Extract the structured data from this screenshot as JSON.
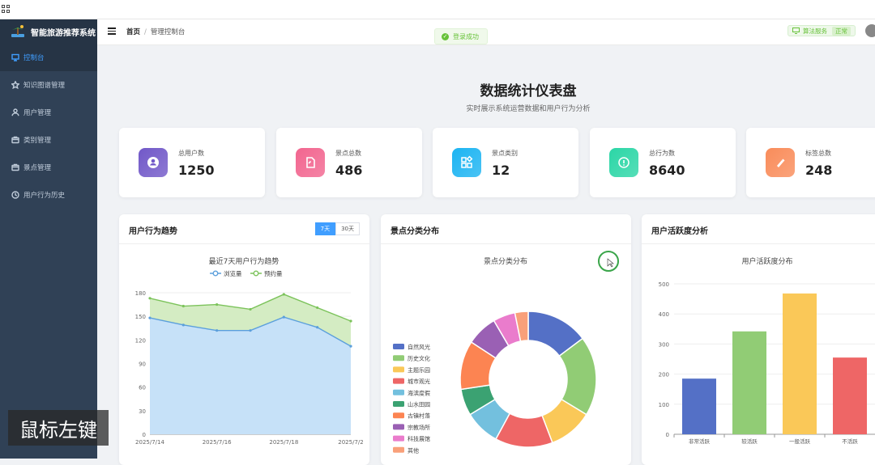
{
  "app": {
    "title": "智能旅游推荐系统"
  },
  "sidebar": {
    "items": [
      {
        "label": "控制台",
        "icon": "monitor-icon",
        "active": true
      },
      {
        "label": "知识图谱管理",
        "icon": "star-icon"
      },
      {
        "label": "用户管理",
        "icon": "user-icon"
      },
      {
        "label": "类别管理",
        "icon": "folder-icon"
      },
      {
        "label": "景点管理",
        "icon": "folder-icon"
      },
      {
        "label": "用户行为历史",
        "icon": "clock-icon"
      }
    ]
  },
  "header": {
    "breadcrumb": [
      "首页",
      "管理控制台"
    ],
    "algo_label": "算法服务",
    "algo_status": "正常"
  },
  "toast": {
    "text": "登录成功"
  },
  "dashboard": {
    "title": "数据统计仪表盘",
    "subtitle": "实时展示系统运营数据和用户行为分析"
  },
  "stats": [
    {
      "label": "总用户数",
      "value": "1250",
      "color": "#7158c8"
    },
    {
      "label": "景点总数",
      "value": "486",
      "color": "#f2658f"
    },
    {
      "label": "景点类别",
      "value": "12",
      "color": "#1cb4f2"
    },
    {
      "label": "总行为数",
      "value": "8640",
      "color": "#2bd6a6"
    },
    {
      "label": "标签总数",
      "value": "248",
      "color": "#f98c5a"
    }
  ],
  "cards": {
    "trend": {
      "title": "用户行为趋势",
      "range_options": [
        "7天",
        "30天"
      ],
      "active": "7天"
    },
    "category": {
      "title": "景点分类分布"
    },
    "activity": {
      "title": "用户活跃度分析"
    }
  },
  "overlay": {
    "text": "鼠标左键"
  },
  "chart_data": [
    {
      "type": "area",
      "title": "最近7天用户行为趋势",
      "series": [
        {
          "name": "浏览量",
          "color": "#5b9fdc",
          "values": [
            148,
            139,
            132,
            132,
            149,
            136,
            112
          ]
        },
        {
          "name": "预约量",
          "color": "#7cc35b",
          "values": [
            173,
            163,
            165,
            159,
            178,
            161,
            144
          ]
        }
      ],
      "x_ticks": [
        "2025/7/14",
        "2025/7/16",
        "2025/7/18",
        "2025/7/2"
      ],
      "ylim": [
        0,
        180
      ],
      "yticks": [
        0,
        30,
        60,
        90,
        120,
        150,
        180
      ]
    },
    {
      "type": "pie",
      "title": "景点分类分布",
      "categories": [
        "自然风光",
        "历史文化",
        "主题乐园",
        "城市观光",
        "海滨度假",
        "山水田园",
        "古镇村落",
        "宗教场所",
        "科技展馆",
        "其他"
      ],
      "values": [
        14,
        18,
        10,
        13,
        8,
        6,
        11,
        7,
        5,
        3
      ],
      "colors": [
        "#5470c6",
        "#91cc75",
        "#fac858",
        "#ee6666",
        "#73c0de",
        "#3ba272",
        "#fc8452",
        "#9a60b4",
        "#ea7ccc",
        "#f9a07a"
      ]
    },
    {
      "type": "bar",
      "title": "用户活跃度分布",
      "categories": [
        "非常活跃",
        "较活跃",
        "一般活跃",
        "不活跃"
      ],
      "values": [
        185,
        342,
        468,
        255
      ],
      "colors": [
        "#5470c6",
        "#91cc75",
        "#fac858",
        "#ee6666"
      ],
      "ylim": [
        0,
        500
      ],
      "yticks": [
        0,
        100,
        200,
        300,
        400,
        500
      ]
    }
  ]
}
